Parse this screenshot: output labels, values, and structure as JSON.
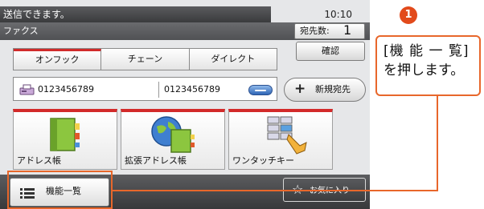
{
  "status": {
    "message": "送信できます。",
    "time": "10:10"
  },
  "screen": {
    "title": "ファクス"
  },
  "dest": {
    "label": "宛先数:",
    "count": "1"
  },
  "confirm_label": "確認",
  "tabs": [
    {
      "label": "オンフック"
    },
    {
      "label": "チェーン"
    },
    {
      "label": "ダイレクト"
    }
  ],
  "number_bar": {
    "left": "0123456789",
    "right": "0123456789"
  },
  "new_dest_label": "新規宛先",
  "tiles": [
    {
      "label": "アドレス帳"
    },
    {
      "label": "拡張アドレス帳"
    },
    {
      "label": "ワンタッチキー"
    }
  ],
  "function_menu_label": "機能一覧",
  "favorites_label": "お気に入り",
  "callout": {
    "step": "1",
    "line1": "[機 能 一 覧]",
    "line2": "を押します。"
  },
  "colors": {
    "accent": "#e8672b",
    "tab_highlight": "#d32a2a"
  }
}
